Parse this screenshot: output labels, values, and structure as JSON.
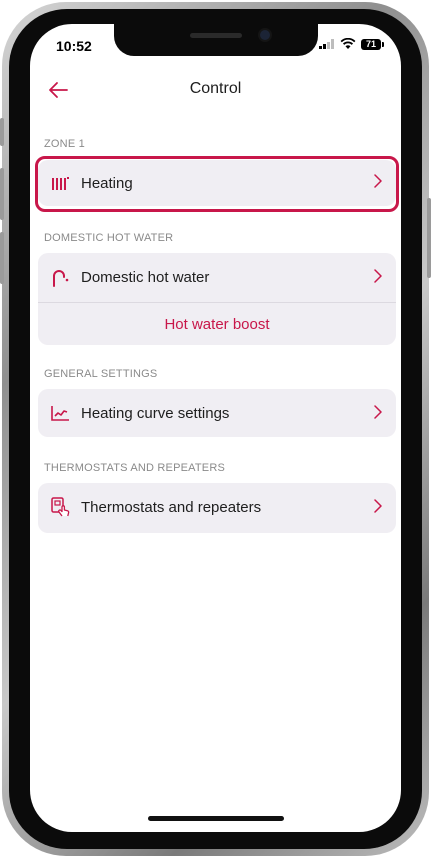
{
  "status_bar": {
    "time": "10:52",
    "battery": "71"
  },
  "header": {
    "title": "Control"
  },
  "sections": {
    "zone1": {
      "label": "ZONE 1",
      "heating": {
        "label": "Heating",
        "icon": "radiator-icon"
      }
    },
    "dhw": {
      "label": "DOMESTIC HOT WATER",
      "dhw_row": {
        "label": "Domestic hot water",
        "icon": "faucet-icon"
      },
      "boost": {
        "label": "Hot water boost"
      }
    },
    "general": {
      "label": "GENERAL SETTINGS",
      "curve": {
        "label": "Heating curve settings",
        "icon": "curve-chart-icon"
      }
    },
    "thermostats": {
      "label": "THERMOSTATS AND REPEATERS",
      "row": {
        "label": "Thermostats and repeaters",
        "icon": "thermostat-device-icon"
      }
    }
  },
  "colors": {
    "accent": "#c8174a",
    "card_bg": "#f0eef3",
    "section_label": "#8a8a8a"
  }
}
